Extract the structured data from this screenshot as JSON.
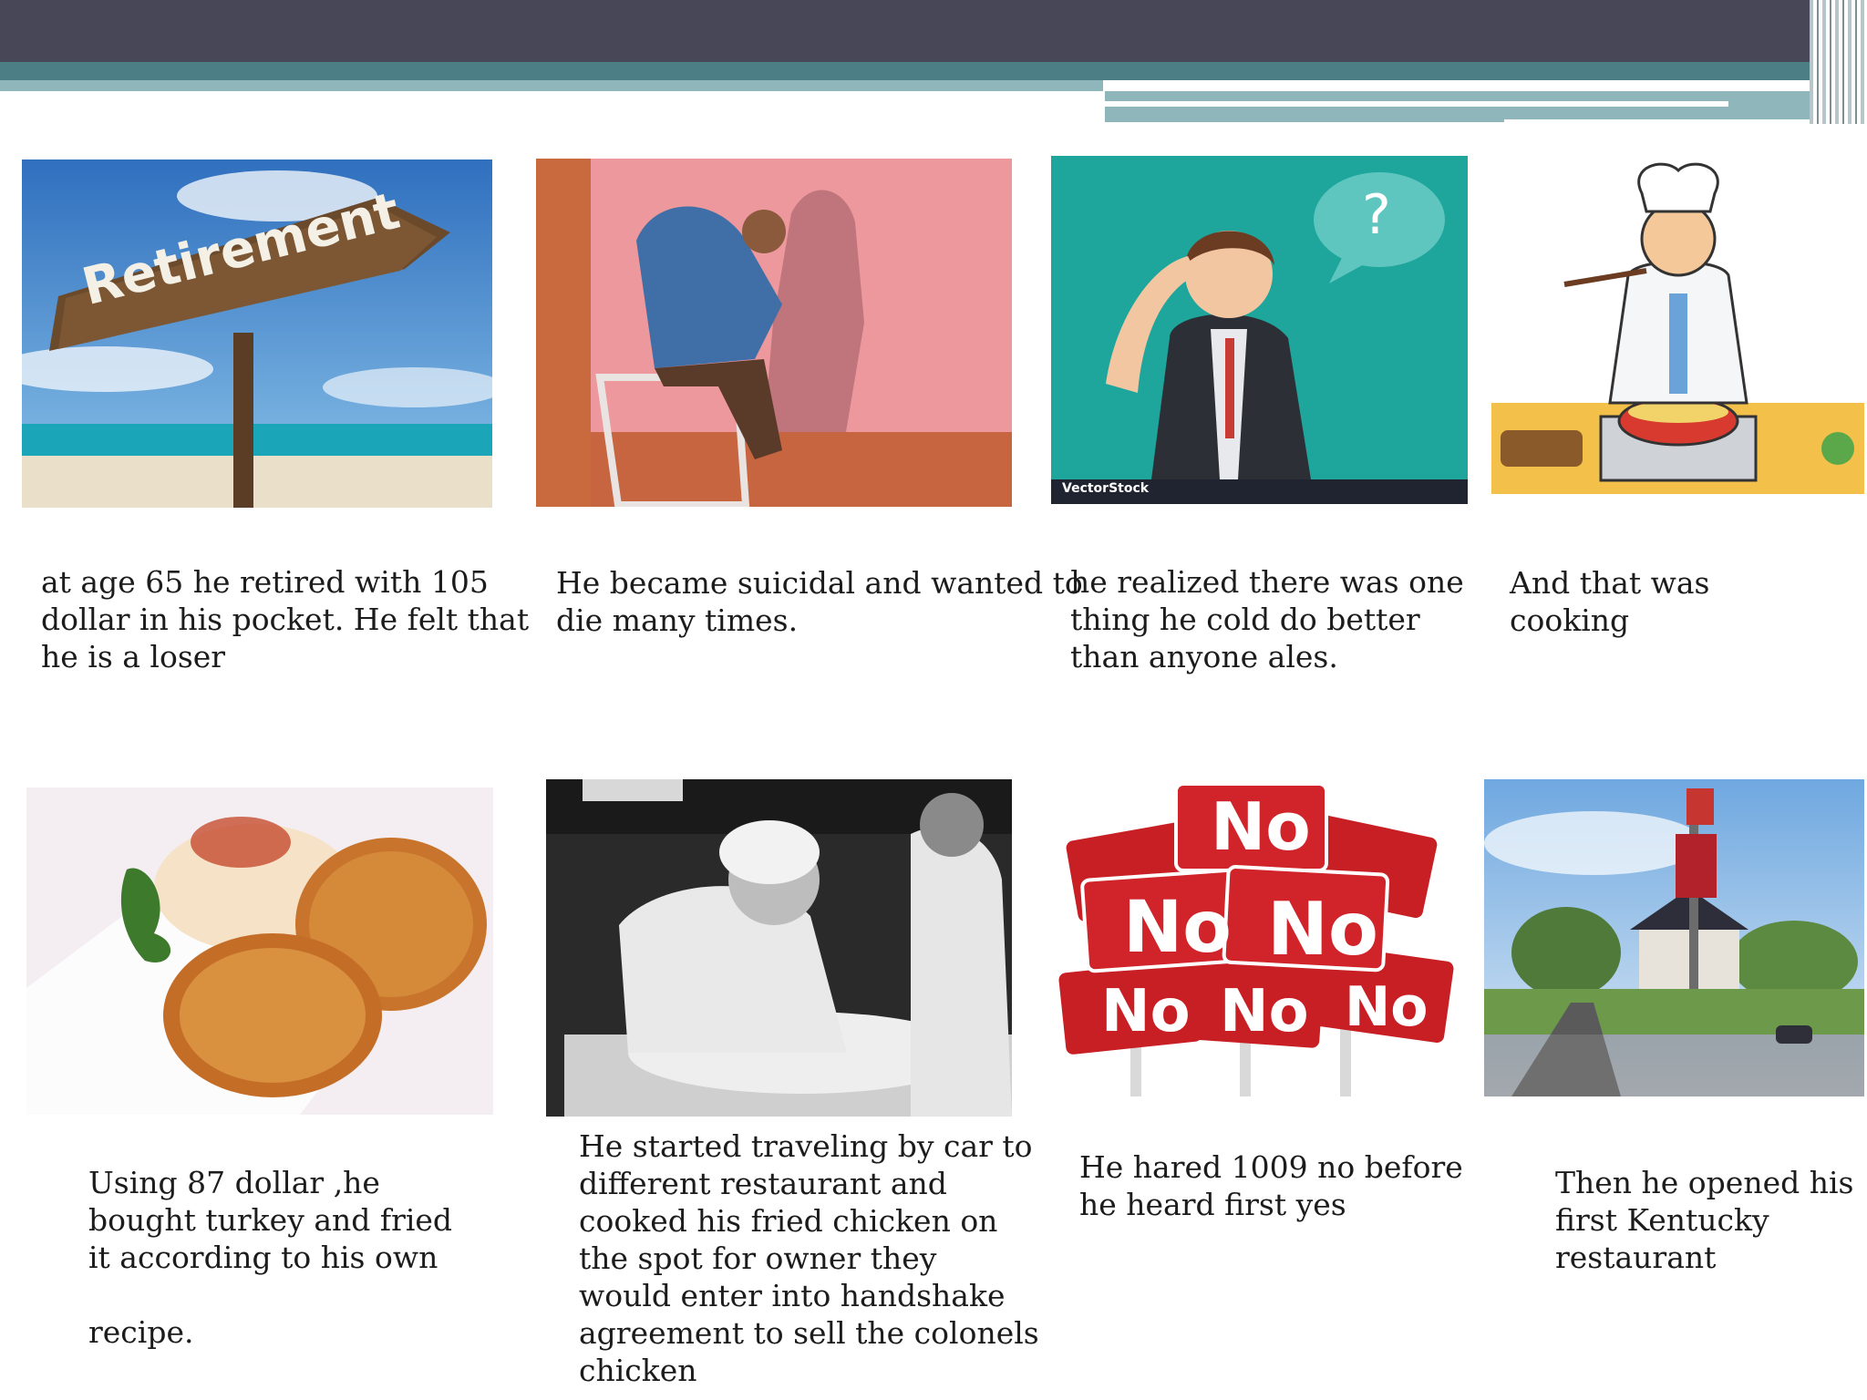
{
  "slide": {
    "panels": [
      {
        "id": "retirement",
        "sign_text": "Retirement",
        "caption": "at age 65 he retired with 105\ndollar in his pocket. He felt that\nhe is a loser"
      },
      {
        "id": "despair",
        "caption": "He became suicidal and wanted to\ndie many times."
      },
      {
        "id": "realization",
        "bubble_text": "?",
        "watermark": "VectorStock",
        "caption": "he realized there was one\nthing he cold do better\nthan anyone ales."
      },
      {
        "id": "cooking",
        "caption": "And that was\ncooking"
      },
      {
        "id": "chicken",
        "caption": "Using 87 dollar ,he\nbought turkey and fried\nit according to his own\n\nrecipe."
      },
      {
        "id": "traveling",
        "caption": "He started traveling by car to\ndifferent restaurant and\ncooked his fried chicken on\nthe spot for owner they\nwould enter into handshake\nagreement to sell the colonels\nchicken"
      },
      {
        "id": "rejections",
        "sign_word": "No",
        "caption": "He hared 1009 no before\nhe heard first yes"
      },
      {
        "id": "restaurant",
        "caption": "Then he opened his\nfirst  Kentucky\nrestaurant"
      }
    ]
  }
}
